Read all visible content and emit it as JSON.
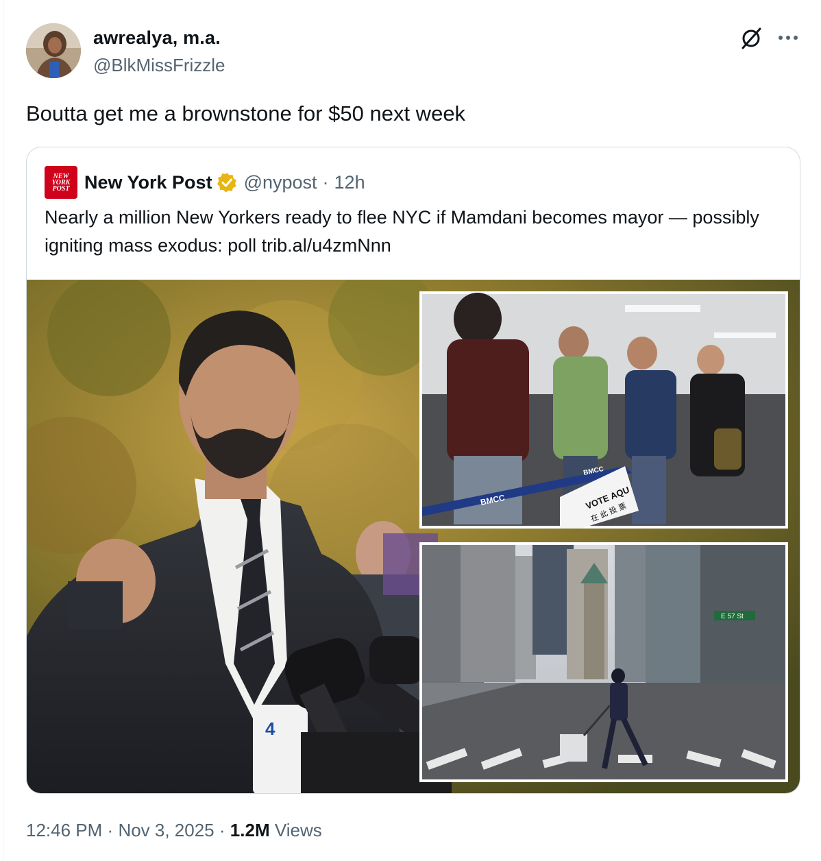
{
  "author": {
    "display_name": "awrealya, m.a.",
    "handle": "@BlkMissFrizzle",
    "avatar_icon": "avatar-photo"
  },
  "tweet": {
    "text": "Boutta get me a brownstone for $50 next week"
  },
  "quote": {
    "logo_lines": [
      "NEW",
      "YORK",
      "POST"
    ],
    "name": "New York Post",
    "verified_icon": "gold-verified-badge-icon",
    "handle": "@nypost",
    "separator": "·",
    "time": "12h",
    "text": "Nearly a million New Yorkers ready to flee NYC if Mamdani becomes mayor — possibly igniting mass exodus: poll trib.al/u4zmNnn",
    "media": {
      "inset_top_labels": {
        "barrier": "BMCC",
        "barrier2": "BMCC",
        "sign_line1": "VOTE AQU",
        "sign_line2": "在 此 投 票"
      },
      "inset_bottom_labels": {
        "street_sign": "E 57 St"
      },
      "mic_logo": "4"
    }
  },
  "meta": {
    "time": "12:46 PM",
    "sep1": "·",
    "date": "Nov 3, 2025",
    "sep2": "·",
    "views_count": "1.2M",
    "views_label": "Views"
  },
  "colors": {
    "text": "#0f1419",
    "secondary": "#536471",
    "border": "#cfd9de",
    "nyp_red": "#d0021b",
    "badge_gold": "#e8b514"
  }
}
